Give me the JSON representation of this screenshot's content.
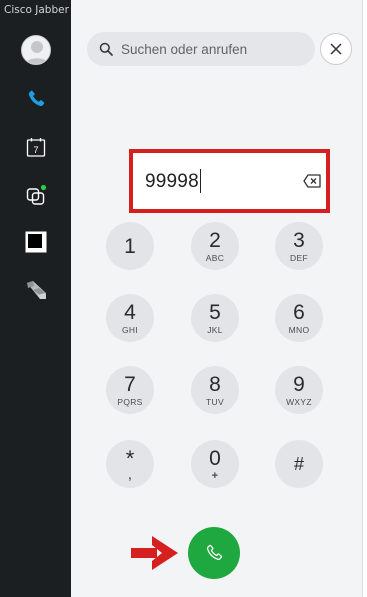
{
  "app": {
    "title": "Cisco Jabber"
  },
  "sidebar": {
    "items": [
      {
        "name": "phone",
        "icon": "phone-icon",
        "active": true,
        "color": "#1ba1e2"
      },
      {
        "name": "calendar",
        "icon": "calendar-icon",
        "day": "7"
      },
      {
        "name": "chat",
        "icon": "chat-icon",
        "status_color": "#2ecc40"
      },
      {
        "name": "square",
        "icon": "square-icon"
      },
      {
        "name": "stairs",
        "icon": "stairs-icon"
      }
    ]
  },
  "search": {
    "placeholder": "Suchen oder anrufen"
  },
  "dialer": {
    "number": "99998",
    "keys": [
      {
        "digit": "1",
        "letters": ""
      },
      {
        "digit": "2",
        "letters": "ABC"
      },
      {
        "digit": "3",
        "letters": "DEF"
      },
      {
        "digit": "4",
        "letters": "GHI"
      },
      {
        "digit": "5",
        "letters": "JKL"
      },
      {
        "digit": "6",
        "letters": "MNO"
      },
      {
        "digit": "7",
        "letters": "PQRS"
      },
      {
        "digit": "8",
        "letters": "TUV"
      },
      {
        "digit": "9",
        "letters": "WXYZ"
      },
      {
        "digit": "*",
        "letters": ","
      },
      {
        "digit": "0",
        "letters": "+"
      },
      {
        "digit": "#",
        "letters": ""
      }
    ]
  },
  "colors": {
    "sidebar_bg": "#1b1f21",
    "accent_blue": "#1ba1e2",
    "call_green": "#1fa83f",
    "highlight_red": "#d61f1f"
  }
}
